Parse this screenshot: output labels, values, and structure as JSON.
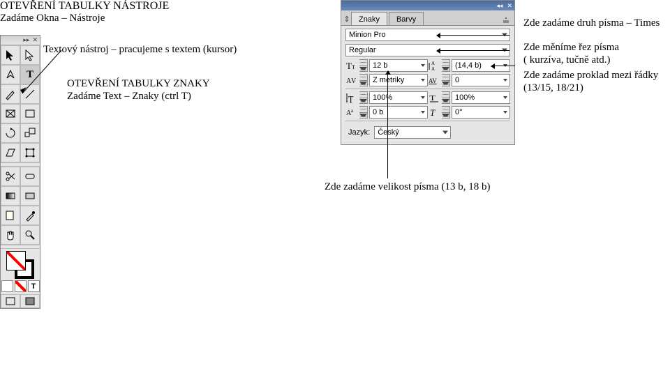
{
  "titles": {
    "line1": "OTEVŘENÍ TABULKY NÁSTROJE",
    "line2": "Zadáme Okna – Nástroje"
  },
  "descriptions": {
    "textTool": "Textový nástroj – pracujeme s textem (kursor)",
    "znakyTitle": "OTEVŘENÍ TABULKY ZNAKY",
    "znakySub": "Zadáme Text – Znaky (ctrl T)"
  },
  "charPanel": {
    "tabs": {
      "active": "Znaky",
      "inactive": "Barvy"
    },
    "font": "Minion Pro",
    "style": "Regular",
    "size": "12 b",
    "leading": "(14,4 b)",
    "kerning": "Z metriky",
    "tracking": "0",
    "vscale": "100%",
    "hscale": "100%",
    "baseline": "0 b",
    "skew": "0°",
    "langLabel": "Jazyk:",
    "language": "Český"
  },
  "annotations": {
    "font": "Zde zadáme druh písma – Times",
    "style1": "Zde měníme řez písma",
    "style2": "( kurzíva, tučně atd.)",
    "leading1": "Zde zadáme proklad mezi řádky",
    "leading2": "(13/15, 18/21)",
    "sizeBottom": "Zde zadáme velikost písma (13 b, 18 b)"
  }
}
